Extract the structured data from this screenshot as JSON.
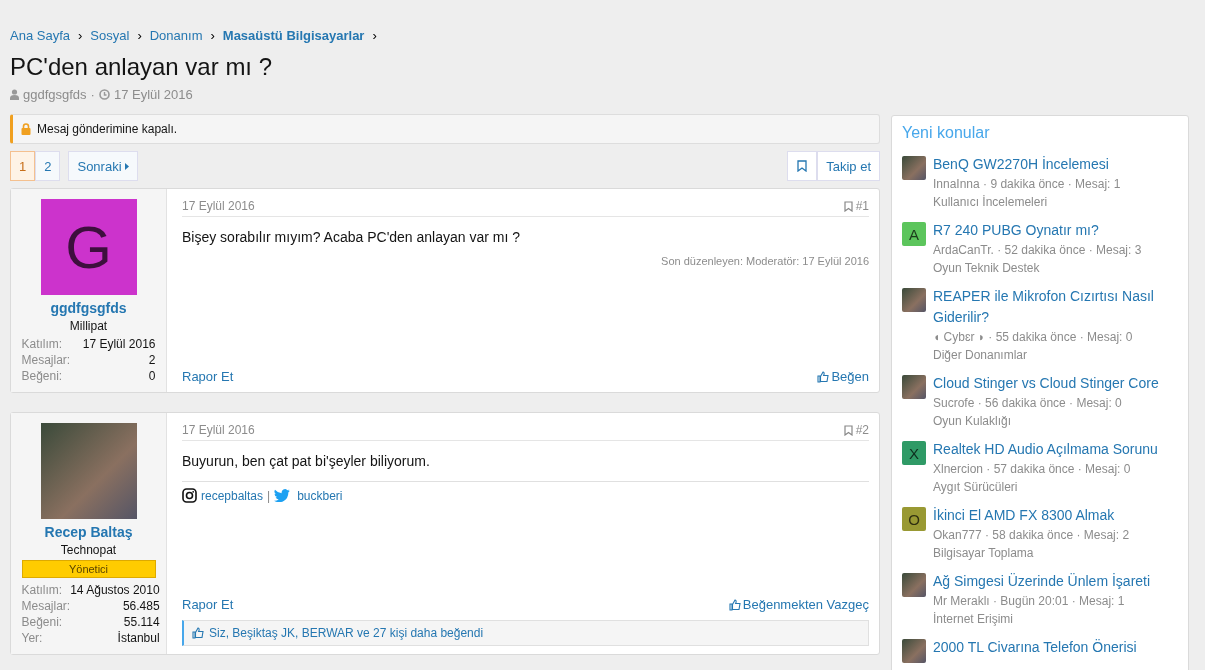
{
  "breadcrumb": [
    {
      "label": "Ana Sayfa",
      "current": false
    },
    {
      "label": "Sosyal",
      "current": false
    },
    {
      "label": "Donanım",
      "current": false
    },
    {
      "label": "Masaüstü Bilgisayarlar",
      "current": true
    }
  ],
  "breadcrumb_separator": "›",
  "thread": {
    "title": "PC'den anlayan var mı ?",
    "author": "ggdfgsgfds",
    "separator": "·",
    "date": "17 Eylül 2016"
  },
  "notice": "Mesaj gönderimine kapalı.",
  "pagination": {
    "pages": [
      {
        "label": "1",
        "selected": true
      },
      {
        "label": "2",
        "selected": false
      }
    ],
    "next": "Sonraki"
  },
  "watch_button": "Takip et",
  "posts": [
    {
      "avatar": {
        "kind": "letter",
        "letter": "G",
        "color": "#cc33cc"
      },
      "username": "ggdfgsgfds",
      "user_title": "Millipat",
      "stats": [
        {
          "label": "Katılım:",
          "value": "17 Eylül 2016"
        },
        {
          "label": "Mesajlar:",
          "value": "2"
        },
        {
          "label": "Beğeni:",
          "value": "0"
        }
      ],
      "date": "17 Eylül 2016",
      "number": "#1",
      "body": "Bişey sorabılır mıyım? Acaba PC'den anlayan var mı ?",
      "edited": "Son düzenleyen: Moderatör: 17 Eylül 2016",
      "report": "Rapor Et",
      "like": "Beğen"
    },
    {
      "avatar": {
        "kind": "photo"
      },
      "username": "Recep Baltaş",
      "user_title": "Technopat",
      "banner": "Yönetici",
      "stats": [
        {
          "label": "Katılım:",
          "value": "14 Ağustos 2010"
        },
        {
          "label": "Mesajlar:",
          "value": "56.485"
        },
        {
          "label": "Beğeni:",
          "value": "55.114"
        },
        {
          "label": "Yer:",
          "value": "İstanbul"
        }
      ],
      "date": "17 Eylül 2016",
      "number": "#2",
      "body": "Buyurun, ben çat pat bi'şeyler biliyorum.",
      "signature": {
        "instagram": "recepbaltas",
        "separator": "|",
        "twitter": "buckberi"
      },
      "report": "Rapor Et",
      "like": "Beğenmekten Vazgeç",
      "liked_by": "Siz, Beşiktaş JK, BERWAR ve 27 kişi daha beğendi"
    }
  ],
  "sidebar": {
    "title": "Yeni konular",
    "items": [
      {
        "avatar": {
          "kind": "photo"
        },
        "title": "BenQ GW2270H İncelemesi",
        "meta": "InnaInna · 9 dakika önce · Mesaj: 1",
        "forum": "Kullanıcı İncelemeleri"
      },
      {
        "avatar": {
          "kind": "letter",
          "letter": "A",
          "color": "#5cc55c"
        },
        "title": "R7 240 PUBG Oynatır mı?",
        "meta": "ArdaCanTr. · 52 dakika önce · Mesaj: 3",
        "forum": "Oyun Teknik Destek"
      },
      {
        "avatar": {
          "kind": "photo"
        },
        "title": "REAPER ile Mikrofon Cızırtısı Nasıl Giderilir?",
        "meta": "◖ Cybɛr ◗ · 55 dakika önce · Mesaj: 0",
        "forum": "Diğer Donanımlar"
      },
      {
        "avatar": {
          "kind": "photo"
        },
        "title": "Cloud Stinger vs Cloud Stinger Core",
        "meta": "Sucrofe · 56 dakika önce · Mesaj: 0",
        "forum": "Oyun Kulaklığı"
      },
      {
        "avatar": {
          "kind": "letter",
          "letter": "X",
          "color": "#2f9a66"
        },
        "title": "Realtek HD Audio Açılmama Sorunu",
        "meta": "Xlnercion · 57 dakika önce · Mesaj: 0",
        "forum": "Aygıt Sürücüleri"
      },
      {
        "avatar": {
          "kind": "letter",
          "letter": "O",
          "color": "#999933"
        },
        "title": "İkinci El AMD FX 8300 Almak",
        "meta": "Okan777 · 58 dakika önce · Mesaj: 2",
        "forum": "Bilgisayar Toplama"
      },
      {
        "avatar": {
          "kind": "photo"
        },
        "title": "Ağ Simgesi Üzerinde Ünlem İşareti",
        "meta": "Mr Meraklı · Bugün 20:01 · Mesaj: 1",
        "forum": "İnternet Erişimi"
      },
      {
        "avatar": {
          "kind": "photo"
        },
        "title": "2000 TL Civarına Telefon Önerisi"
      }
    ]
  }
}
